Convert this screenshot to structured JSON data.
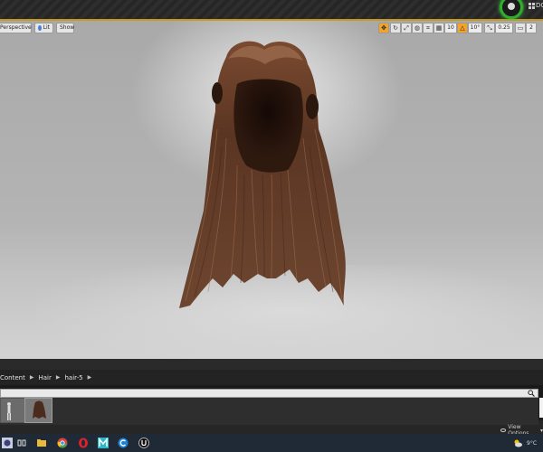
{
  "topbar": {
    "label": "DC"
  },
  "viewport": {
    "perspective_label": "Perspective",
    "lit_label": "Lit",
    "show_label": "Show",
    "snap_grid_value": "10",
    "snap_angle_value": "10°",
    "snap_scale_value": "0.25",
    "camera_speed_value": "2"
  },
  "content_browser": {
    "breadcrumb": [
      "Content",
      "Hair",
      "hair-5"
    ],
    "view_options_label": "View Options"
  },
  "taskbar": {
    "temperature": "9°C"
  },
  "colors": {
    "accent": "#c79a1e",
    "hair_dark": "#3a2217",
    "hair_light": "#8a5a3c"
  }
}
